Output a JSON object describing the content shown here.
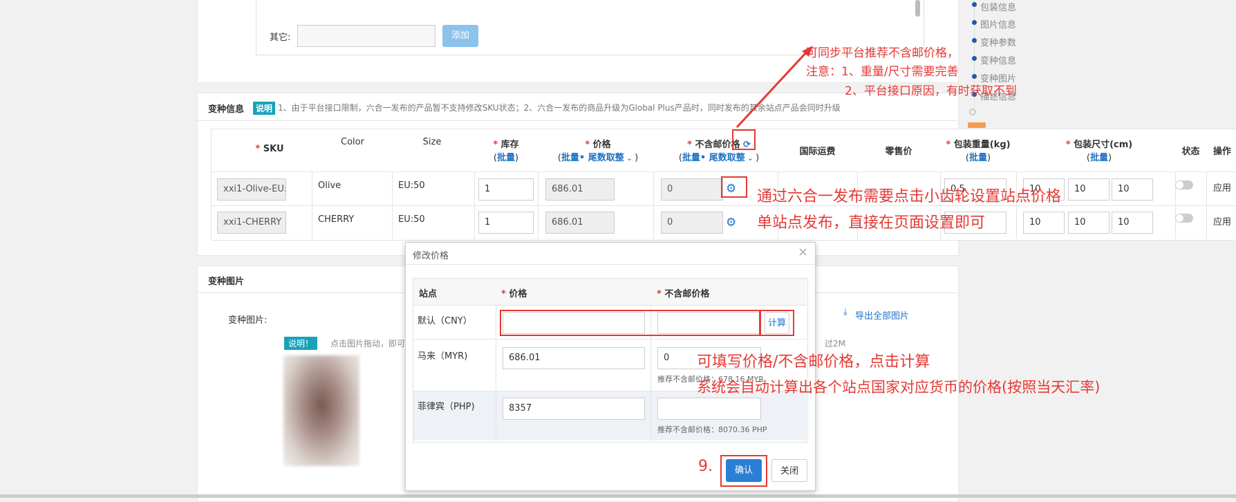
{
  "top_form": {
    "other_label": "其它:",
    "add_button": "添加"
  },
  "variant_info": {
    "title": "变种信息",
    "note_badge": "说明",
    "note_text": "1、由于平台接口限制，六合一发布的产品暂不支持修改SKU状态；2、六合一发布的商品升级为Global Plus产品时，同时发布的其余站点产品会同时升级",
    "columns": {
      "sku": "SKU",
      "color": "Color",
      "size": "Size",
      "stock": "库存",
      "price": "价格",
      "price_excl_shipping": "不含邮价格",
      "intl_shipping": "国际运费",
      "retail_price": "零售价",
      "pack_weight": "包装重量(kg)",
      "pack_size": "包装尺寸(cm)",
      "status": "状态",
      "action": "操作"
    },
    "batch_label": "批量",
    "rounding_label": "尾数取整",
    "rows": [
      {
        "sku": "xxi1-Olive-EU:",
        "color": "Olive",
        "size": "EU:50",
        "stock": "1",
        "price": "686.01",
        "price_excl": "0",
        "weight": "0.5",
        "dim1": "10",
        "dim2": "10",
        "dim3": "10",
        "action": "应用"
      },
      {
        "sku": "xxi1-CHERRY",
        "color": "CHERRY",
        "size": "EU:50",
        "stock": "1",
        "price": "686.01",
        "price_excl": "0",
        "weight": "",
        "dim1": "10",
        "dim2": "10",
        "dim3": "10",
        "action": "应用"
      }
    ]
  },
  "variant_images": {
    "title": "变种图片",
    "label": "变种图片:",
    "note_badge": "说明！",
    "note_text": "点击图片拖动，即可",
    "note_tail": "过2M",
    "export_all": "导出全部图片"
  },
  "modal": {
    "title": "修改价格",
    "col_site": "站点",
    "col_price": "价格",
    "col_price_excl": "不含邮价格",
    "calc_button": "计算",
    "rows": [
      {
        "site": "默认（CNY）",
        "price": "",
        "price_excl": "",
        "hint": ""
      },
      {
        "site": "马来（MYR)",
        "price": "686.01",
        "price_excl": "0",
        "hint": "推荐不含邮价格：678.16 MYR"
      },
      {
        "site": "菲律宾（PHP)",
        "price": "8357",
        "price_excl": "",
        "hint": "推荐不含邮价格：8070.36 PHP"
      }
    ],
    "confirm": "确认",
    "close": "关闭"
  },
  "side_nav": {
    "items": [
      "包装信息",
      "图片信息",
      "变种参数",
      "变种信息",
      "变种图片",
      "描述信息"
    ]
  },
  "annotations": {
    "sync_line1": "可同步平台推荐不含邮价格，",
    "sync_line2": "注意：1、重量/尺寸需要完善",
    "sync_line3": "2、平台接口原因，有时获取不到",
    "gear_line1": "通过六合一发布需要点击小齿轮设置站点价格",
    "gear_line2": "单站点发布，直接在页面设置即可",
    "calc_line1": "可填写价格/不含邮价格，点击计算",
    "calc_line2": "系统会自动计算出各个站点国家对应货币的价格(按照当天汇率)",
    "step": "9."
  },
  "colors": {
    "annotation": "#e53935",
    "primary": "#1e73c9",
    "teal_badge": "#17a2b8"
  }
}
